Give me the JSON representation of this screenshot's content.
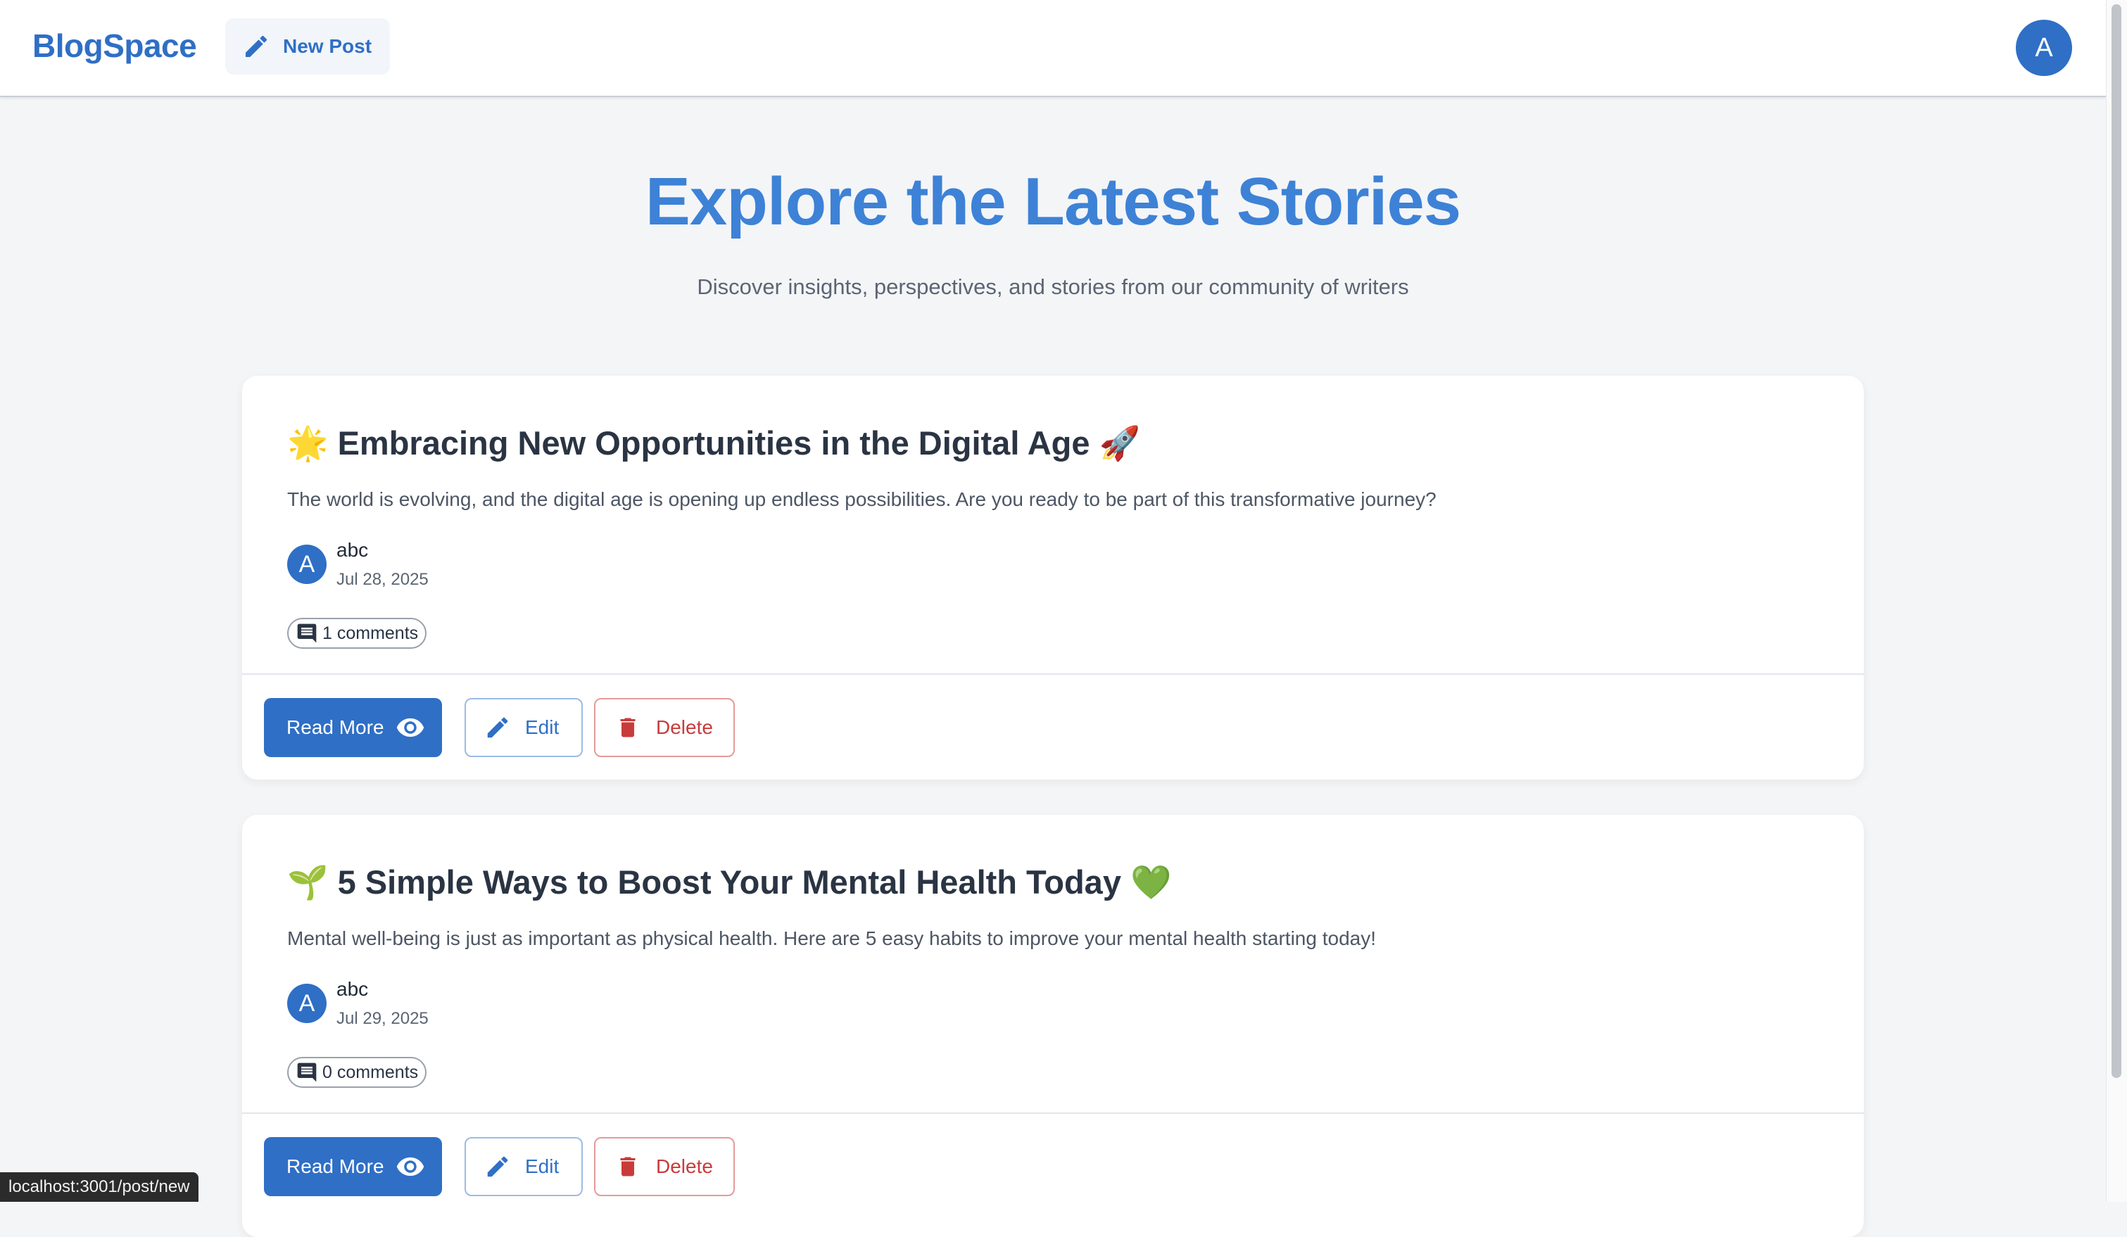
{
  "header": {
    "brand": "BlogSpace",
    "new_post_label": "New Post",
    "user_initial": "A"
  },
  "hero": {
    "title": "Explore the Latest Stories",
    "subtitle": "Discover insights, perspectives, and stories from our community of writers"
  },
  "posts": [
    {
      "title": "🌟 Embracing New Opportunities in the Digital Age 🚀",
      "excerpt": "The world is evolving, and the digital age is opening up endless possibilities. Are you ready to be part of this transformative journey?",
      "author_initial": "A",
      "author": "abc",
      "date": "Jul 28, 2025",
      "comments": "1 comments"
    },
    {
      "title": "🌱 5 Simple Ways to Boost Your Mental Health Today 💚",
      "excerpt": "Mental well-being is just as important as physical health. Here are 5 easy habits to improve your mental health starting today!",
      "author_initial": "A",
      "author": "abc",
      "date": "Jul 29, 2025",
      "comments": "0 comments"
    }
  ],
  "actions": {
    "read_more": "Read More",
    "edit": "Edit",
    "delete": "Delete"
  },
  "icons": {
    "new_post": "pencil-icon",
    "read_more": "eye-icon",
    "edit": "pencil-icon",
    "delete": "trash-icon",
    "comments": "comment-icon"
  },
  "colors": {
    "brand": "#2f6fc6",
    "hero_title": "#3d82d6",
    "delete": "#c93b3b"
  },
  "status_bar": {
    "url": "localhost:3001/post/new"
  }
}
